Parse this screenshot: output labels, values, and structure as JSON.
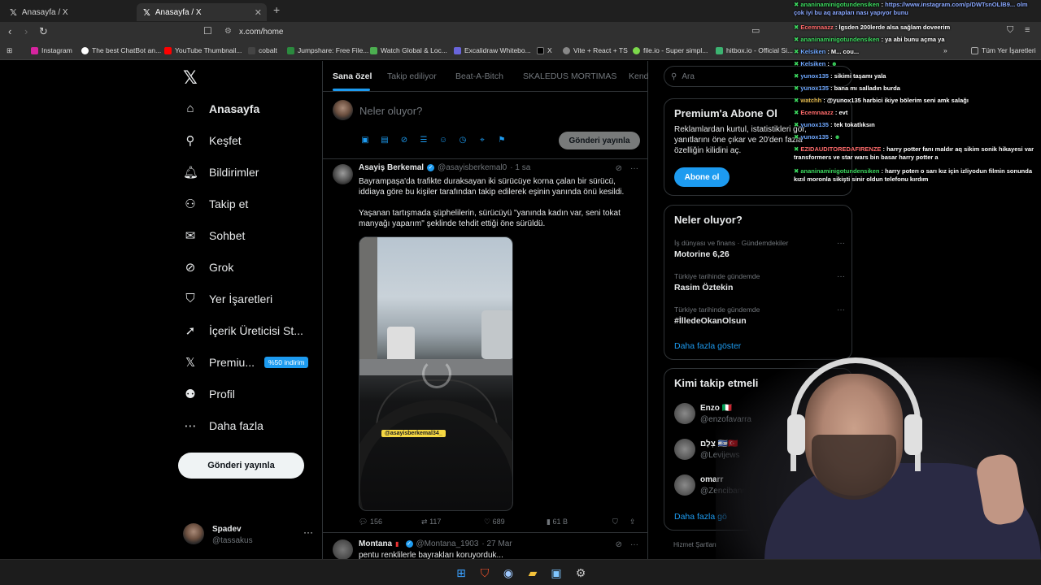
{
  "browser": {
    "tabs": [
      {
        "title": "Anasayfa / X"
      },
      {
        "title": "Anasayfa / X"
      }
    ],
    "url": "x.com/home",
    "bookmarks": [
      "Instagram",
      "The best ChatBot an...",
      "YouTube Thumbnail...",
      "cobalt",
      "Jumpshare: Free File...",
      "Watch Global & Loc...",
      "Excalidraw Whitebo...",
      "X",
      "Vite + React + TS",
      "file.io - Super simpl...",
      "hitbox.io - Official Si...",
      "Tüm Yer İşaretleri"
    ]
  },
  "sidebar": {
    "items": [
      {
        "label": "Anasayfa",
        "icon": "home-icon"
      },
      {
        "label": "Keşfet",
        "icon": "search-icon"
      },
      {
        "label": "Bildirimler",
        "icon": "bell-icon"
      },
      {
        "label": "Takip et",
        "icon": "add-user-icon"
      },
      {
        "label": "Sohbet",
        "icon": "mail-icon"
      },
      {
        "label": "Grok",
        "icon": "grok-icon"
      },
      {
        "label": "Yer İşaretleri",
        "icon": "bookmark-icon"
      },
      {
        "label": "İçerik Üreticisi St...",
        "icon": "rocket-icon"
      },
      {
        "label": "Premiu...",
        "icon": "x-icon",
        "badge": "%50 indirim"
      },
      {
        "label": "Profil",
        "icon": "user-icon"
      },
      {
        "label": "Daha fazla",
        "icon": "more-icon"
      }
    ],
    "post_button": "Gönderi yayınla",
    "profile": {
      "name": "Spadev",
      "handle": "@tassakus"
    }
  },
  "feed": {
    "tabs": [
      "Sana özel",
      "Takip ediliyor",
      "Beat-A-Bitch",
      "SKALEDUS MORTIMAS",
      "Kend"
    ],
    "composer": {
      "placeholder": "Neler oluyor?",
      "button": "Gönderi yayınla"
    },
    "tweet": {
      "name": "Asayiş Berkemal",
      "handle": "@asayisberkemal0",
      "time": "· 1 sa",
      "text1": "Bayrampaşa'da trafikte duraksayan iki sürücüye korna çalan bir sürücü, iddiaya göre bu kişiler tarafından takip edilerek eşinin yanında önü kesildi.",
      "text2": "Yaşanan tartışmada şüphelilerin, sürücüyü \"yanında kadın var, seni tokat manyağı yaparım\" şeklinde tehdit ettiği öne sürüldü.",
      "watermark": "@asayisberkemal34_",
      "replies": "156",
      "reposts": "117",
      "likes": "689",
      "views": "61 B"
    },
    "tweet2": {
      "name": "Montana",
      "handle": "@Montana_1903",
      "time": "· 27 Mar",
      "text": "pentu renklilerle bayrakları koruyorduk..."
    }
  },
  "right": {
    "search_placeholder": "Ara",
    "premium": {
      "title": "Premium'a Abone Ol",
      "desc": "Reklamlardan kurtul, istatistikleri gör, yanıtlarını öne çıkar ve 20'den fazla özelliğin kilidini aç.",
      "button": "Abone ol"
    },
    "trends_title": "Neler oluyor?",
    "trends": [
      {
        "category": "İş dünyası ve finans · Gündemdekiler",
        "title": "Motorine 6,26"
      },
      {
        "category": "Türkiye tarihinde gündemde",
        "title": "Rasim Öztekin"
      },
      {
        "category": "Türkiye tarihinde gündemde",
        "title": "#İlledeOkanOlsun"
      }
    ],
    "show_more": "Daha fazla göster",
    "who_title": "Kimi takip etmeli",
    "who": [
      {
        "name": "Enzo 🇮🇹",
        "handle": "@enzofavarra"
      },
      {
        "name": "צְלָם 🇮🇱🇹🇷",
        "handle": "@Levijews"
      },
      {
        "name": "omarr",
        "handle": "@Zencibann"
      }
    ],
    "who_more": "Daha fazla gö",
    "footer": "Hizmet Şartları"
  },
  "chat": [
    {
      "user": "ananinaminigotundensiken",
      "msg": "https://www.instagram.com/p/DWTsnOLlB9... olm çok iyi bu aq arapları nası yapıyor bunu"
    },
    {
      "user": "Ecemnaazz",
      "msg": "İgsden 200lerde alsa sağlam doveerim"
    },
    {
      "user": "ananinaminigotundensiken",
      "msg": "ya abi bunu açma ya"
    },
    {
      "user": "Kelsiken",
      "msg": "M... cou..."
    },
    {
      "user": "Kelsiken",
      "msg": ""
    },
    {
      "user": "yunox135",
      "msg": "sikimi taşamı yala"
    },
    {
      "user": "yunox135",
      "msg": "bana mı salladın burda"
    },
    {
      "user": "watchh",
      "msg": "@yunox135 harbici ikiye bölerim seni amk salağı"
    },
    {
      "user": "Ecemnaazz",
      "msg": "evt"
    },
    {
      "user": "yunox135",
      "msg": "tek tokatlıksın"
    },
    {
      "user": "yunox135",
      "msg": ""
    },
    {
      "user": "EZIDAUDITOREDAFIRENZE",
      "msg": "harry potter fanı maldır aq sikim sonik hikayesi var transformers ve star wars bin basar harry potter a"
    },
    {
      "user": "ananinaminigotundensiken",
      "msg": "harry poterı o sarı kız için izliyodun filmin sonunda kızıl moronla sikişti sinir oldun telefonu kırdım"
    }
  ]
}
